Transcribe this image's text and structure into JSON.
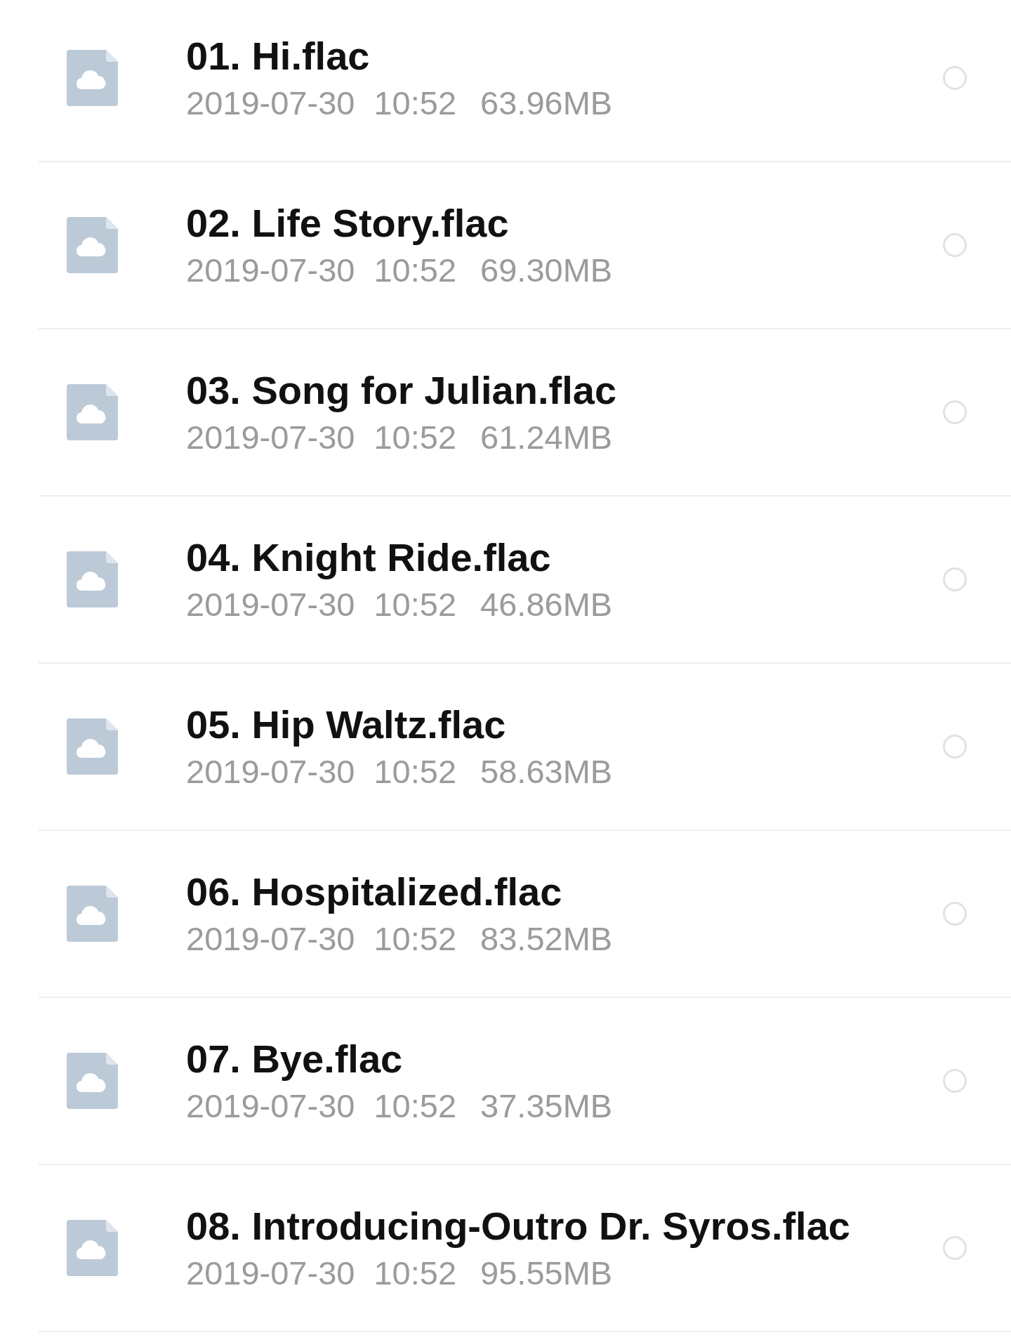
{
  "files": [
    {
      "name": "01. Hi.flac",
      "date": "2019-07-30",
      "time": "10:52",
      "size": "63.96MB",
      "selected": false
    },
    {
      "name": "02. Life Story.flac",
      "date": "2019-07-30",
      "time": "10:52",
      "size": "69.30MB",
      "selected": false
    },
    {
      "name": "03. Song for Julian.flac",
      "date": "2019-07-30",
      "time": "10:52",
      "size": "61.24MB",
      "selected": false
    },
    {
      "name": "04. Knight Ride.flac",
      "date": "2019-07-30",
      "time": "10:52",
      "size": "46.86MB",
      "selected": false
    },
    {
      "name": "05. Hip Waltz.flac",
      "date": "2019-07-30",
      "time": "10:52",
      "size": "58.63MB",
      "selected": false
    },
    {
      "name": "06. Hospitalized.flac",
      "date": "2019-07-30",
      "time": "10:52",
      "size": "83.52MB",
      "selected": false
    },
    {
      "name": "07. Bye.flac",
      "date": "2019-07-30",
      "time": "10:52",
      "size": "37.35MB",
      "selected": false
    },
    {
      "name": "08. Introducing-Outro Dr. Syros.flac",
      "date": "2019-07-30",
      "time": "10:52",
      "size": "95.55MB",
      "selected": false
    }
  ]
}
